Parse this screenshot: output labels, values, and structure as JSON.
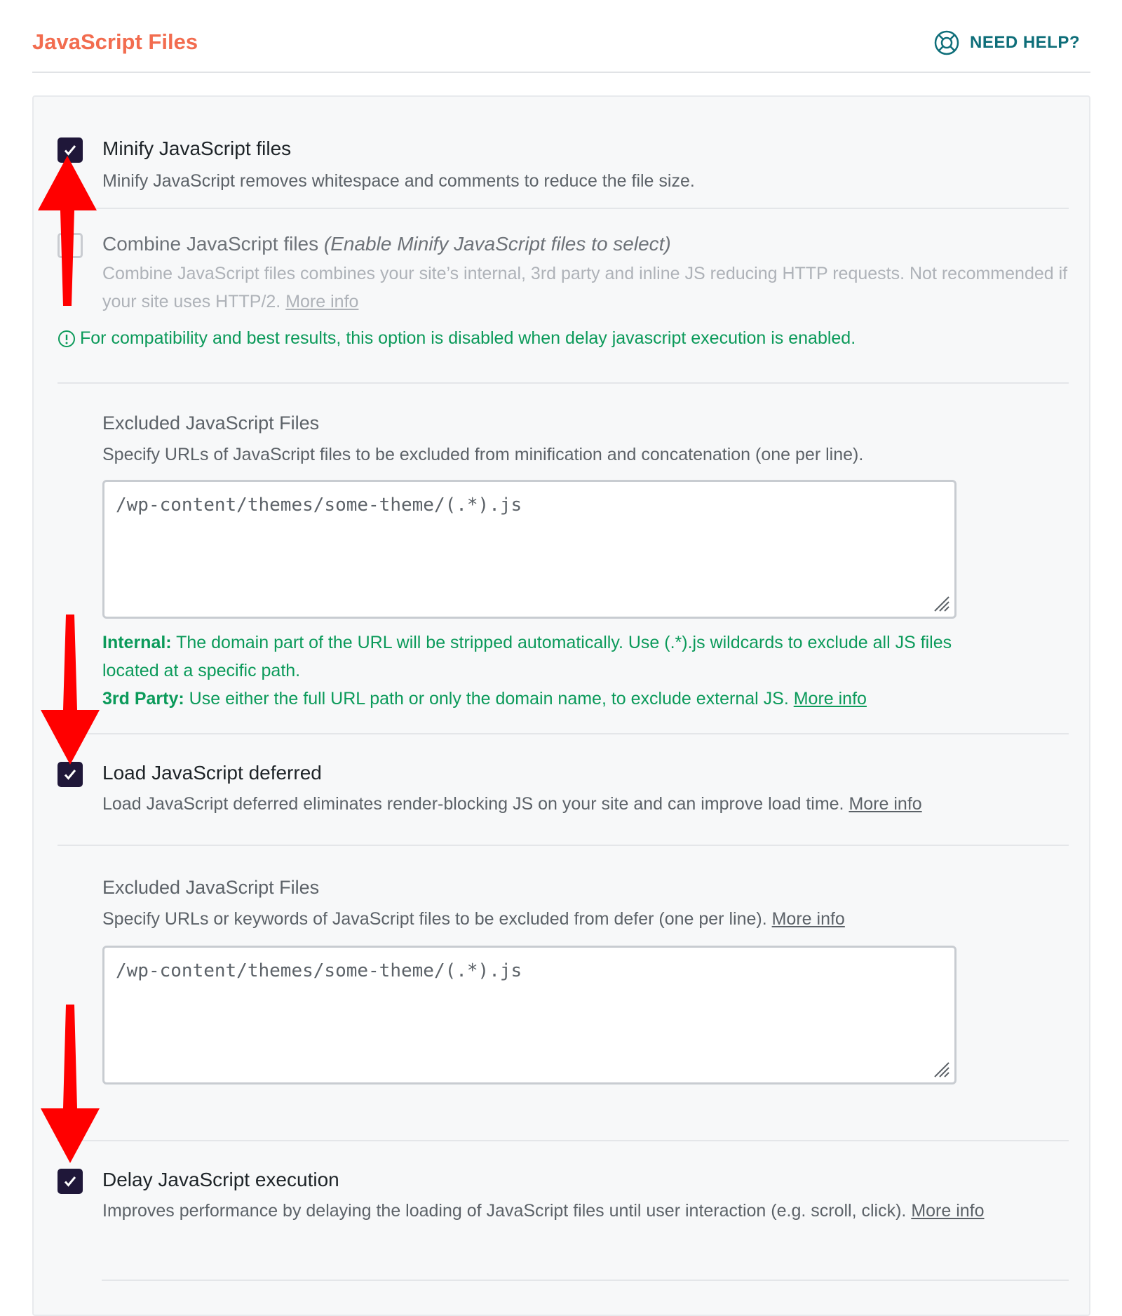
{
  "header": {
    "title": "JavaScript Files",
    "help_label": "NEED HELP?"
  },
  "minify": {
    "checked": true,
    "label": "Minify JavaScript files",
    "description": "Minify JavaScript removes whitespace and comments to reduce the file size."
  },
  "combine": {
    "checked": false,
    "disabled": true,
    "label": "Combine JavaScript files",
    "label_note": "(Enable Minify JavaScript files to select)",
    "description": "Combine JavaScript files combines your site’s internal, 3rd party and inline JS reducing HTTP requests. Not recommended if your site uses HTTP/2.",
    "more_info": "More info",
    "warning": "For compatibility and best results, this option is disabled when delay javascript execution is enabled."
  },
  "excluded_minify": {
    "title": "Excluded JavaScript Files",
    "description": "Specify URLs of JavaScript files to be excluded from minification and concatenation (one per line).",
    "placeholder": "/wp-content/themes/some-theme/(.*).js",
    "internal_label": "Internal:",
    "internal_text": "The domain part of the URL will be stripped automatically. Use (.*).js wildcards to exclude all JS files located at a specific path.",
    "third_party_label": "3rd Party:",
    "third_party_text": "Use either the full URL path or only the domain name, to exclude external JS.",
    "more_info": "More info"
  },
  "defer": {
    "checked": true,
    "label": "Load JavaScript deferred",
    "description": "Load JavaScript deferred eliminates render-blocking JS on your site and can improve load time.",
    "more_info": "More info"
  },
  "excluded_defer": {
    "title": "Excluded JavaScript Files",
    "description": "Specify URLs or keywords of JavaScript files to be excluded from defer (one per line).",
    "more_info": "More info",
    "placeholder": "/wp-content/themes/some-theme/(.*).js"
  },
  "delay": {
    "checked": true,
    "label": "Delay JavaScript execution",
    "description": "Improves performance by delaying the loading of JavaScript files until user interaction (e.g. scroll, click).",
    "more_info": "More info"
  },
  "colors": {
    "accent": "#f26c4f",
    "help": "#0e6e79",
    "checkbox": "#1f1739",
    "success": "#0b9a5a",
    "annotation_arrow": "#ff0000"
  }
}
